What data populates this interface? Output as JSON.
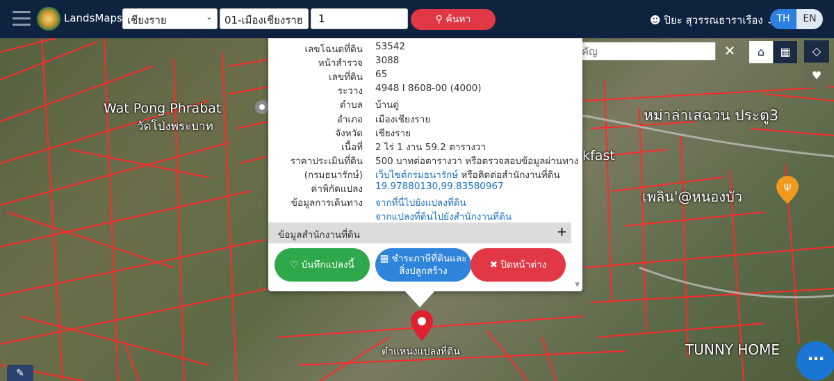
{
  "navbar": {
    "brand": "LandsMaps",
    "province": "เชียงราย",
    "amphoe": "01-เมืองเชียงราย",
    "parcel_value": "1",
    "search_label": "ค้นหา",
    "user_name": "ปิยะ สุวรรณธาราเรือง",
    "lang_th": "TH",
    "lang_en": "EN"
  },
  "landmark_search": {
    "placeholder": "ค้นหาสถานที่สำคัญ"
  },
  "map_labels": {
    "wat_en": "Wat Pong Phrabat",
    "wat_th": "วัดโป่งพระบาท",
    "place_1": "หม่าล่าเสฉวน ประตู3",
    "place_2": "kfast",
    "place_3": "เพลิน'@หนองบัว",
    "place_4": "TUNNY HOME",
    "marker_label": "ตำแหน่งแปลงที่ดิน"
  },
  "parcel": {
    "rows": [
      {
        "key": "เลขโฉนดที่ดิน",
        "value": "53542"
      },
      {
        "key": "หน้าสำรวจ",
        "value": "3088"
      },
      {
        "key": "เลขที่ดิน",
        "value": "65"
      },
      {
        "key": "ระวาง",
        "value": "4948 I 8608-00 (4000)"
      },
      {
        "key": "ตำบล",
        "value": "บ้านดู่"
      },
      {
        "key": "อำเภอ",
        "value": "เมืองเชียงราย"
      },
      {
        "key": "จังหวัด",
        "value": "เชียงราย"
      },
      {
        "key": "เนื้อที่",
        "value": "2 ไร่ 1 งาน 59.2 ตารางวา"
      },
      {
        "key": "ราคาประเมินที่ดิน",
        "value": "500 บาทต่อตารางวา หรือตรวจสอบข้อมูลผ่านทาง"
      },
      {
        "key": "(กรมธนารักษ์)",
        "value_link": "เว็บไซต์กรมธนารักษ์",
        "value_rest": " หรือติดต่อสำนักงานที่ดิน"
      },
      {
        "key": "ค่าพิกัดแปลง",
        "value_link": "19.97880130,99.83580967"
      },
      {
        "key": "ข้อมูลการเดินทาง",
        "value_link": "จากที่นี่ไปยังแปลงที่ดิน"
      },
      {
        "key": "",
        "value_link": "จากแปลงที่ดินไปยังสำนักงานที่ดิน"
      }
    ],
    "office_section": "ข้อมูลสำนักงานที่ดิน",
    "btn_save": "บันทึกแปลงนี้",
    "btn_tax_line1": "ชำระภาษีที่ดินและ",
    "btn_tax_line2": "สิ่งปลูกสร้าง",
    "btn_close": "ปิดหน้าต่าง"
  },
  "colors": {
    "navbar": "#0f2340",
    "search_red": "#e23744",
    "save_green": "#2ea84a",
    "tax_blue": "#2f84dc",
    "parcel_line": "#ff2a2a",
    "link": "#1a6fc9"
  }
}
